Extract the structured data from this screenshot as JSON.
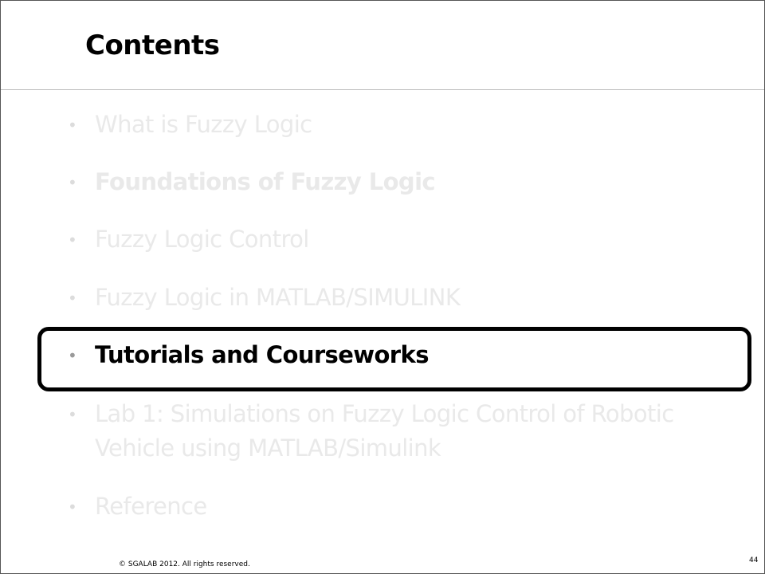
{
  "slide": {
    "title": "Contents",
    "items": [
      {
        "label": "What is Fuzzy Logic"
      },
      {
        "label": "Foundations of Fuzzy Logic"
      },
      {
        "label": "Fuzzy Logic Control"
      },
      {
        "label": "Fuzzy Logic in MATLAB/SIMULINK"
      },
      {
        "label": "Tutorials and Courseworks"
      },
      {
        "label_line1": "Lab 1: Simulations on Fuzzy Logic Control of Robotic",
        "label_line2": "Vehicle using MATLAB/Simulink"
      },
      {
        "label": "Reference"
      }
    ],
    "bullet": "•",
    "active_item": "Tutorials and Courseworks",
    "footer": "© SGALAB 2012. All rights reserved.",
    "page_number": "44"
  }
}
